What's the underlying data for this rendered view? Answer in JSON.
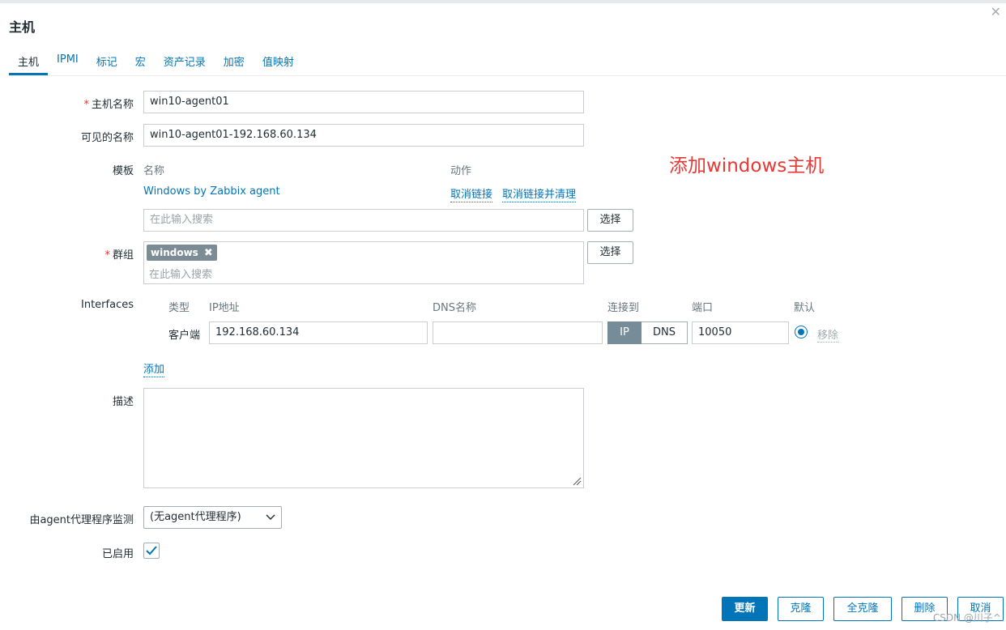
{
  "dialog": {
    "title": "主机",
    "close_icon": "close-icon"
  },
  "tabs": [
    {
      "label": "主机",
      "active": true
    },
    {
      "label": "IPMI"
    },
    {
      "label": "标记"
    },
    {
      "label": "宏"
    },
    {
      "label": "资产记录"
    },
    {
      "label": "加密"
    },
    {
      "label": "值映射"
    }
  ],
  "form": {
    "host_name": {
      "label": "主机名称",
      "value": "win10-agent01",
      "required": true
    },
    "visible_name": {
      "label": "可见的名称",
      "value": "win10-agent01-192.168.60.134"
    },
    "templates": {
      "label": "模板",
      "col_name": "名称",
      "col_action": "动作",
      "linked": [
        {
          "name": "Windows by Zabbix agent",
          "unlink": "取消链接",
          "unlink_clear": "取消链接并清理"
        }
      ],
      "search_placeholder": "在此输入搜索",
      "select_button": "选择"
    },
    "groups": {
      "label": "群组",
      "required": true,
      "chips": [
        "windows"
      ],
      "search_placeholder": "在此输入搜索",
      "select_button": "选择"
    },
    "interfaces": {
      "label": "Interfaces",
      "headers": {
        "type": "类型",
        "ip": "IP地址",
        "dns": "DNS名称",
        "connect": "连接到",
        "port": "端口",
        "default": "默认"
      },
      "rows": [
        {
          "type": "客户端",
          "ip": "192.168.60.134",
          "dns": "",
          "connect_ip": "IP",
          "connect_dns": "DNS",
          "port": "10050",
          "remove": "移除"
        }
      ],
      "add": "添加"
    },
    "description": {
      "label": "描述",
      "value": ""
    },
    "proxy": {
      "label": "由agent代理程序监测",
      "selected": "(无agent代理程序)"
    },
    "enabled": {
      "label": "已启用",
      "checked": true
    }
  },
  "annotation": "添加windows主机",
  "footer": {
    "update": "更新",
    "clone": "克隆",
    "full_clone": "全克隆",
    "delete": "删除",
    "cancel": "取消"
  },
  "watermark": "CSDN @川子^",
  "colors": {
    "accent": "#0275b8",
    "required": "#e33734",
    "annotation": "#e53935",
    "segment_active": "#768d99"
  }
}
